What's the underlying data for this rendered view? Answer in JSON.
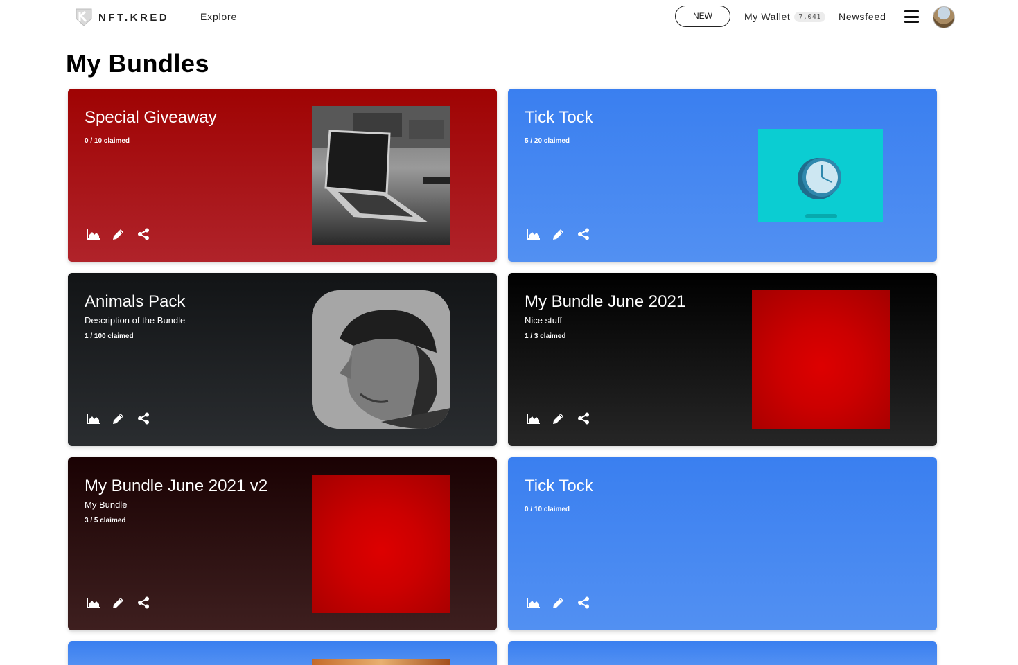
{
  "nav": {
    "brand": "NFT.KRED",
    "explore": "Explore",
    "new_button": "NEW",
    "wallet_label": "My Wallet",
    "wallet_balance": "7,041",
    "newsfeed": "Newsfeed"
  },
  "page": {
    "title": "My Bundles"
  },
  "colors": {
    "red": "#a00505",
    "blue": "#3d80f0",
    "dark": "#1a1c1e"
  },
  "bundles": [
    {
      "title": "Special Giveaway",
      "description": "",
      "claimed": "0 / 10 claimed",
      "theme": "red",
      "thumbnail": "laptop-photo"
    },
    {
      "title": "Tick Tock",
      "description": "",
      "claimed": "5 / 20 claimed",
      "theme": "blue",
      "thumbnail": "clock-illustration"
    },
    {
      "title": "Animals Pack",
      "description": "Description of the Bundle",
      "claimed": "1 / 100 claimed",
      "theme": "dark",
      "thumbnail": "portrait-photo"
    },
    {
      "title": "My Bundle June 2021",
      "description": "Nice stuff",
      "claimed": "1 / 3 claimed",
      "theme": "dark",
      "thumbnail": "red-square"
    },
    {
      "title": "My Bundle June 2021 v2",
      "description": "My Bundle",
      "claimed": "3 / 5 claimed",
      "theme": "maroon",
      "thumbnail": "red-square"
    },
    {
      "title": "Tick Tock",
      "description": "",
      "claimed": "0 / 10 claimed",
      "theme": "blue",
      "thumbnail": ""
    }
  ],
  "icons": {
    "stats": "chart-area-icon",
    "edit": "pencil-icon",
    "share": "share-icon"
  }
}
